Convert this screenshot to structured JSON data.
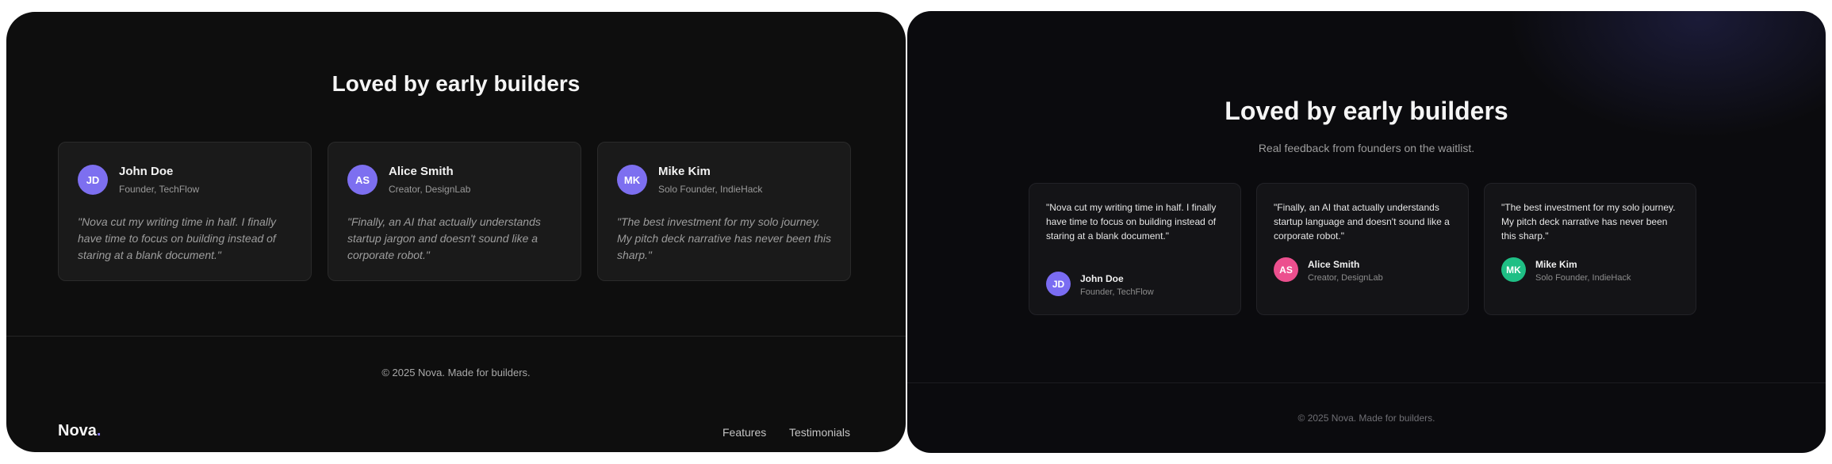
{
  "panel_a": {
    "heading": "Loved by early builders",
    "testimonials": [
      {
        "initials": "JD",
        "name": "John Doe",
        "role": "Founder, TechFlow",
        "quote": "\"Nova cut my writing time in half. I finally have time to focus on building instead of staring at a blank document.\""
      },
      {
        "initials": "AS",
        "name": "Alice Smith",
        "role": "Creator, DesignLab",
        "quote": "\"Finally, an AI that actually understands startup jargon and doesn't sound like a corporate robot.\""
      },
      {
        "initials": "MK",
        "name": "Mike Kim",
        "role": "Solo Founder, IndieHack",
        "quote": "\"The best investment for my solo journey. My pitch deck narrative has never been this sharp.\""
      }
    ],
    "copyright": "© 2025 Nova. Made for builders.",
    "logo": {
      "text": "Nova",
      "dot": "."
    },
    "nav": {
      "features": "Features",
      "testimonials": "Testimonials"
    },
    "colors": {
      "avatar": "#7d6ff0",
      "logo_dot": "#8b7cf8"
    }
  },
  "panel_b": {
    "heading": "Loved by early builders",
    "subheading": "Real feedback from founders on the waitlist.",
    "testimonials": [
      {
        "initials": "JD",
        "name": "John Doe",
        "role": "Founder, TechFlow",
        "avatar_color": "#7a6cf2",
        "quote": "\"Nova cut my writing time in half. I finally have time to focus on building instead of staring at a blank document.\""
      },
      {
        "initials": "AS",
        "name": "Alice Smith",
        "role": "Creator, DesignLab",
        "avatar_color": "#ec4f8e",
        "quote": "\"Finally, an AI that actually understands startup language and doesn't sound like a corporate robot.\""
      },
      {
        "initials": "MK",
        "name": "Mike Kim",
        "role": "Solo Founder, IndieHack",
        "avatar_color": "#1fbf85",
        "quote": "\"The best investment for my solo journey. My pitch deck narrative has never been this sharp.\""
      }
    ],
    "copyright": "© 2025 Nova. Made for builders."
  }
}
